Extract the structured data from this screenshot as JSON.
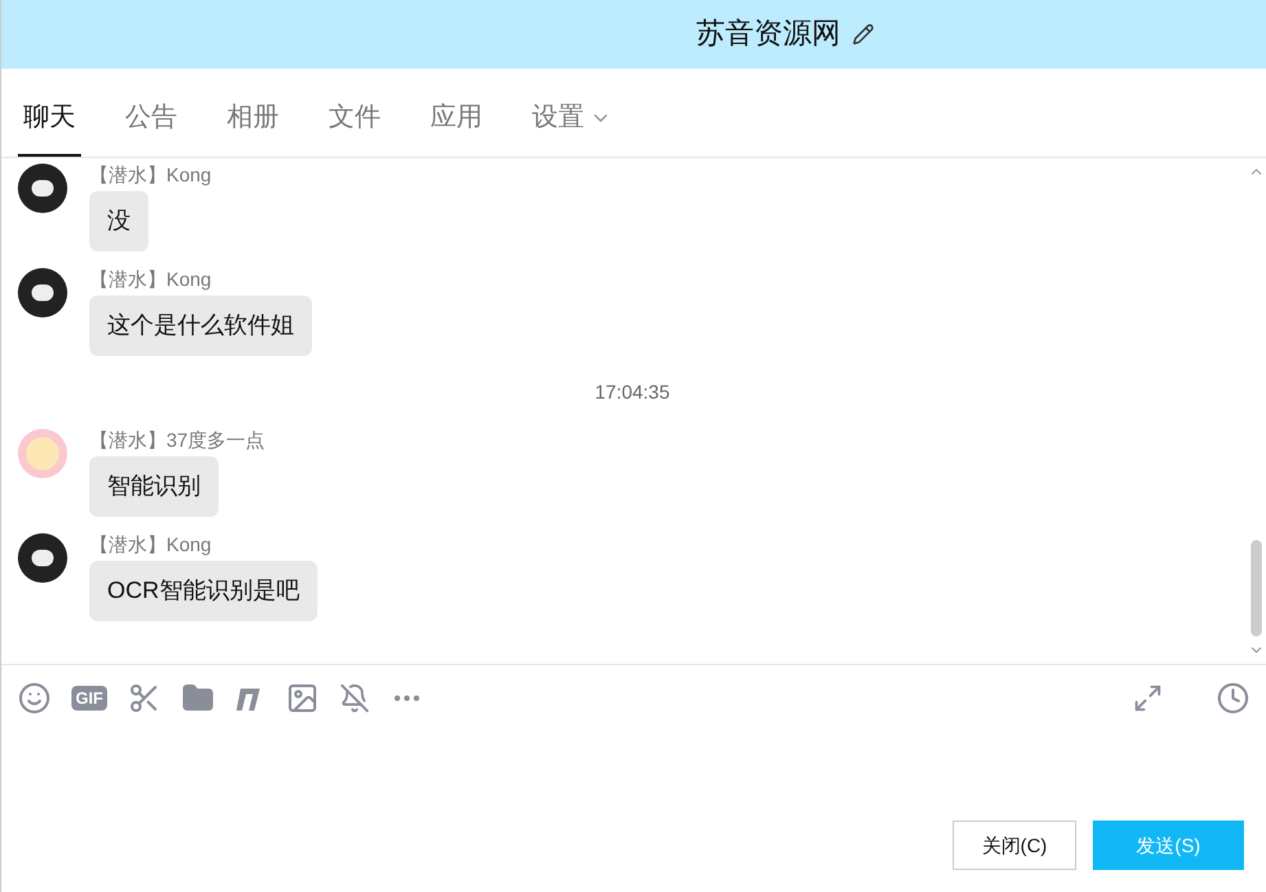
{
  "window": {
    "title": "苏音资源网"
  },
  "tabs": [
    {
      "label": "聊天",
      "selected": true
    },
    {
      "label": "公告",
      "selected": false
    },
    {
      "label": "相册",
      "selected": false
    },
    {
      "label": "文件",
      "selected": false
    },
    {
      "label": "应用",
      "selected": false
    },
    {
      "label": "设置",
      "selected": false,
      "dropdown": true
    }
  ],
  "messages": [
    {
      "kind": "message",
      "sender": "【潜水】Kong",
      "avatar": {
        "kind": "bear"
      },
      "text": "没"
    },
    {
      "kind": "message",
      "sender": "【潜水】Kong",
      "avatar": {
        "kind": "bear"
      },
      "text": "这个是什么软件姐"
    },
    {
      "kind": "time",
      "text": "17:04:35"
    },
    {
      "kind": "message",
      "sender": "【潜水】37度多一点",
      "avatar": {
        "kind": "pink"
      },
      "text": "智能识别"
    },
    {
      "kind": "message",
      "sender": "【潜水】Kong",
      "avatar": {
        "kind": "bear"
      },
      "text": "OCR智能识别是吧"
    }
  ],
  "toolbar": {
    "gif_label": "GIF"
  },
  "buttons": [
    {
      "label": "关闭(C)",
      "kind": "secondary"
    },
    {
      "label": "发送(S)",
      "kind": "primary"
    }
  ]
}
